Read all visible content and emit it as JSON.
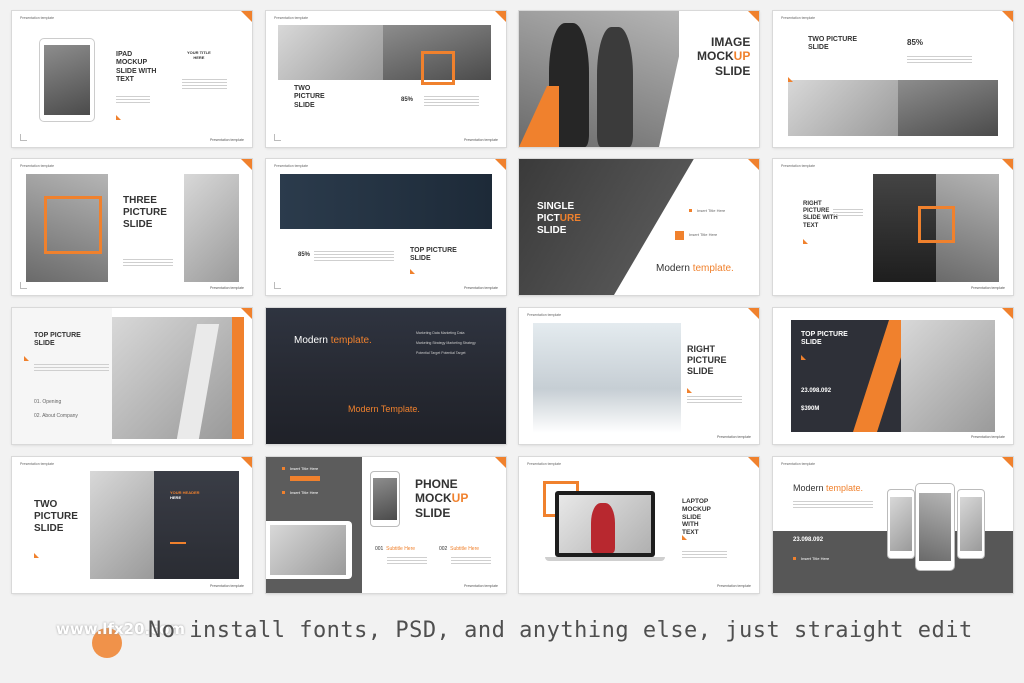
{
  "common": {
    "header": "Presentation template",
    "footer": "Presentation template"
  },
  "slides": {
    "s1": {
      "title1": "IPAD",
      "title2": "MOCKUP",
      "title3": "SLIDE WITH",
      "title4": "TEXT",
      "side_title1": "YOUR TITLE",
      "side_title2": "HERE"
    },
    "s2": {
      "title1": "TWO",
      "title2": "PICTURE",
      "title3": "SLIDE",
      "percent": "85%"
    },
    "s3": {
      "title1": "IMAGE",
      "title2a": "MOCK",
      "title2b": "UP",
      "title3": "SLIDE"
    },
    "s4": {
      "title1": "TWO PICTURE",
      "title2": "SLIDE",
      "percent": "85%"
    },
    "s5": {
      "title1": "THREE",
      "title2": "PICTURE",
      "title3": "SLIDE"
    },
    "s6": {
      "title1": "TOP PICTURE",
      "title2": "SLIDE",
      "percent": "85%"
    },
    "s7": {
      "title1": "SINGLE",
      "title2a": "PICT",
      "title2b": "URE",
      "title3": "SLIDE",
      "item1": "Insert Title Here",
      "item2": "Insert Title Here",
      "tag_a": "Modern ",
      "tag_b": "template."
    },
    "s8": {
      "title1": "RIGHT",
      "title2": "PICTURE",
      "title3": "SLIDE WITH",
      "title4": "TEXT"
    },
    "s9": {
      "title1": "TOP PICTURE",
      "title2": "SLIDE",
      "item1": "01.  Opening",
      "item2": "02.  About Company"
    },
    "s10": {
      "head_a": "Modern ",
      "head_b": "template.",
      "list1": "Marketing Data Marketing Data",
      "list2": "Marketing Strategy Marketing Strategy",
      "list3": "Potential Target Potential Target",
      "center": "Modern Template."
    },
    "s11": {
      "title1": "RIGHT",
      "title2": "PICTURE",
      "title3": "SLIDE"
    },
    "s12": {
      "title1": "TOP PICTURE",
      "title2": "SLIDE",
      "num": "23.098.092",
      "money": "$390M"
    },
    "s13": {
      "title1": "TWO",
      "title2": "PICTURE",
      "title3": "SLIDE",
      "inner1": "YOUR HEADER",
      "inner2": "HERE"
    },
    "s14": {
      "title1": "PHONE",
      "title2a": "MOCK",
      "title2b": "UP",
      "title3": "SLIDE",
      "item1": "Insert Title Here",
      "item2": "Insert Title Here",
      "sub1_num": "001",
      "sub1": "Subtitle Here",
      "sub2_num": "002",
      "sub2": "Subtitle Here"
    },
    "s15": {
      "title1": "LAPTOP",
      "title2": "MOCKUP",
      "title3": "SLIDE",
      "title4": "WITH",
      "title5": "TEXT"
    },
    "s16": {
      "head_a": "Modern ",
      "head_b": "template.",
      "num": "23.098.092",
      "item": "Insert Title Here"
    }
  },
  "caption": "No install fonts, PSD, and anything else, just straight edit",
  "watermark": "www.lfx20.com",
  "colors": {
    "accent": "#f0812d",
    "dark": "#2e3038",
    "background": "#f2f2f2"
  }
}
